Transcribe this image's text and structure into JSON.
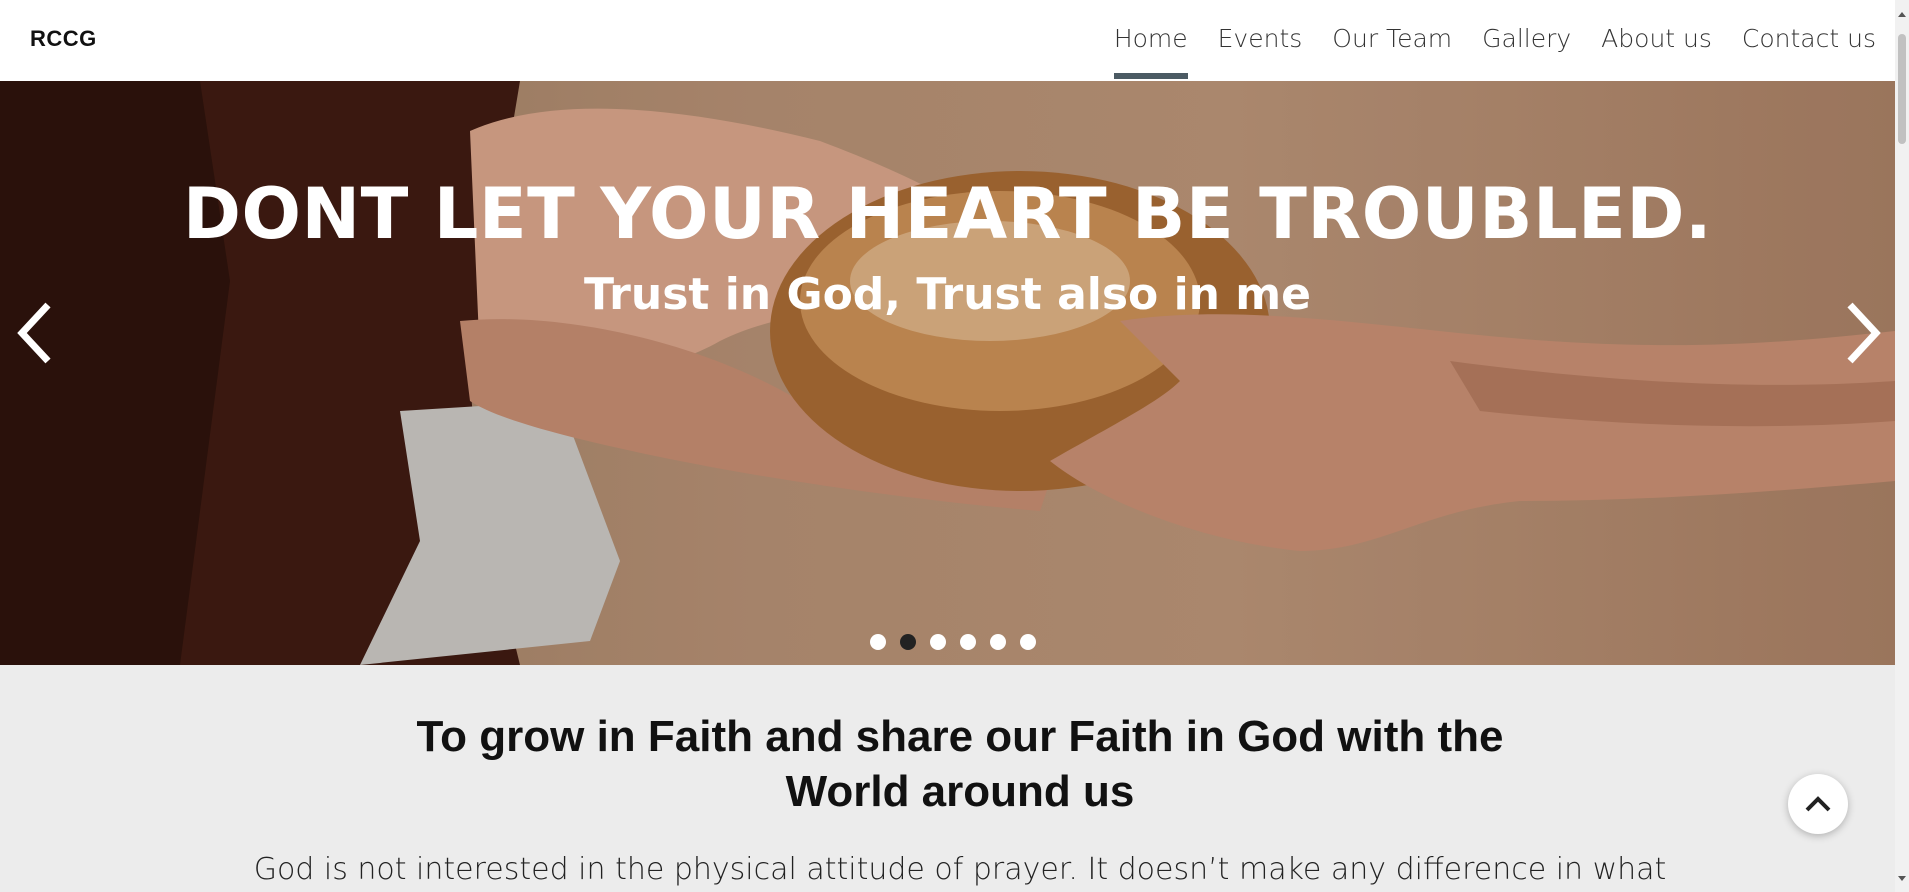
{
  "brand": "RCCG",
  "nav": {
    "items": [
      {
        "label": "Home",
        "active": true
      },
      {
        "label": "Events"
      },
      {
        "label": "Our Team"
      },
      {
        "label": "Gallery"
      },
      {
        "label": "About us"
      },
      {
        "label": "Contact us"
      }
    ]
  },
  "hero": {
    "title": "DONT LET YOUR HEART BE TROUBLED.",
    "subtitle": "Trust in God, Trust also in me",
    "prev_icon": "chevron-left-icon",
    "next_icon": "chevron-right-icon",
    "slides_count": 6,
    "active_slide": 2
  },
  "content": {
    "mission": "To grow in Faith and share our Faith in God with the World around us",
    "paragraph": "God is not interested in the physical attitude of prayer. It doesn’t make any difference in what"
  },
  "scroll_top_icon": "chevron-up-icon",
  "colors": {
    "nav_active_underline": "#4b5a63",
    "content_bg": "#ececec",
    "dot_active": "#222222"
  }
}
